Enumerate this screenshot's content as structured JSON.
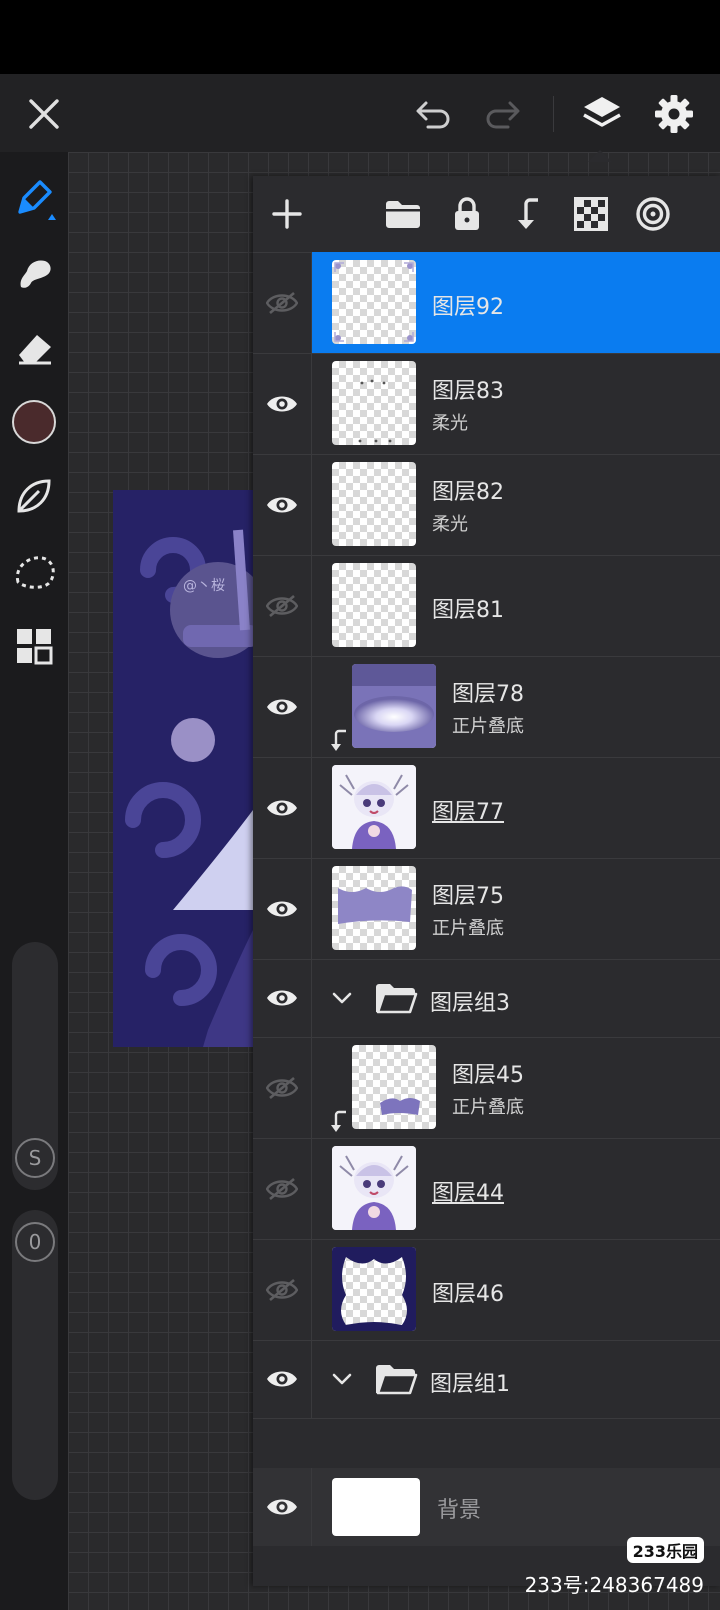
{
  "layers": [
    {
      "name": "图层92",
      "mode": "",
      "visible": false,
      "selected": true,
      "thumb": "frame",
      "underline": false,
      "clipped": false
    },
    {
      "name": "图层83",
      "mode": "柔光",
      "visible": true,
      "selected": false,
      "thumb": "dots",
      "underline": false,
      "clipped": false
    },
    {
      "name": "图层82",
      "mode": "柔光",
      "visible": true,
      "selected": false,
      "thumb": "empty",
      "underline": false,
      "clipped": false
    },
    {
      "name": "图层81",
      "mode": "",
      "visible": false,
      "selected": false,
      "thumb": "empty",
      "underline": false,
      "clipped": false
    },
    {
      "name": "图层78",
      "mode": "正片叠底",
      "visible": true,
      "selected": false,
      "thumb": "purple-glow",
      "underline": false,
      "clipped": true
    },
    {
      "name": "图层77",
      "mode": "",
      "visible": true,
      "selected": false,
      "thumb": "character",
      "underline": true,
      "clipped": false
    },
    {
      "name": "图层75",
      "mode": "正片叠底",
      "visible": true,
      "selected": false,
      "thumb": "purple-band",
      "underline": false,
      "clipped": false
    },
    {
      "group": true,
      "name": "图层组3",
      "visible": true
    },
    {
      "name": "图层45",
      "mode": "正片叠底",
      "visible": false,
      "selected": false,
      "thumb": "small-purple",
      "underline": false,
      "clipped": true
    },
    {
      "name": "图层44",
      "mode": "",
      "visible": false,
      "selected": false,
      "thumb": "character",
      "underline": true,
      "clipped": false
    },
    {
      "name": "图层46",
      "mode": "",
      "visible": false,
      "selected": false,
      "thumb": "navy-frame",
      "underline": false,
      "clipped": false
    },
    {
      "group": true,
      "name": "图层组1",
      "visible": true
    }
  ],
  "background_layer": {
    "name": "背景",
    "visible": true
  },
  "artwork_text": "@丶桜",
  "watermark": {
    "logo": "233乐园",
    "text": "233号:248367489"
  },
  "colors": {
    "accent": "#0a7cf0",
    "current_color": "#4a2a2c",
    "artwork_bg": "#262266"
  },
  "icons": {
    "top": [
      "close-icon",
      "undo-icon",
      "redo-icon",
      "layers-icon",
      "settings-icon"
    ],
    "tools": [
      "brush-icon",
      "smudge-icon",
      "eraser-icon",
      "color-swatch",
      "leaf-icon",
      "lasso-icon",
      "grid-icon"
    ],
    "panel": [
      "add-layer-icon",
      "folder-icon",
      "lock-icon",
      "clip-arrow-icon",
      "transparency-icon",
      "blend-mode-icon"
    ]
  },
  "sliders": {
    "size_label": "S",
    "opacity_label": "0"
  }
}
